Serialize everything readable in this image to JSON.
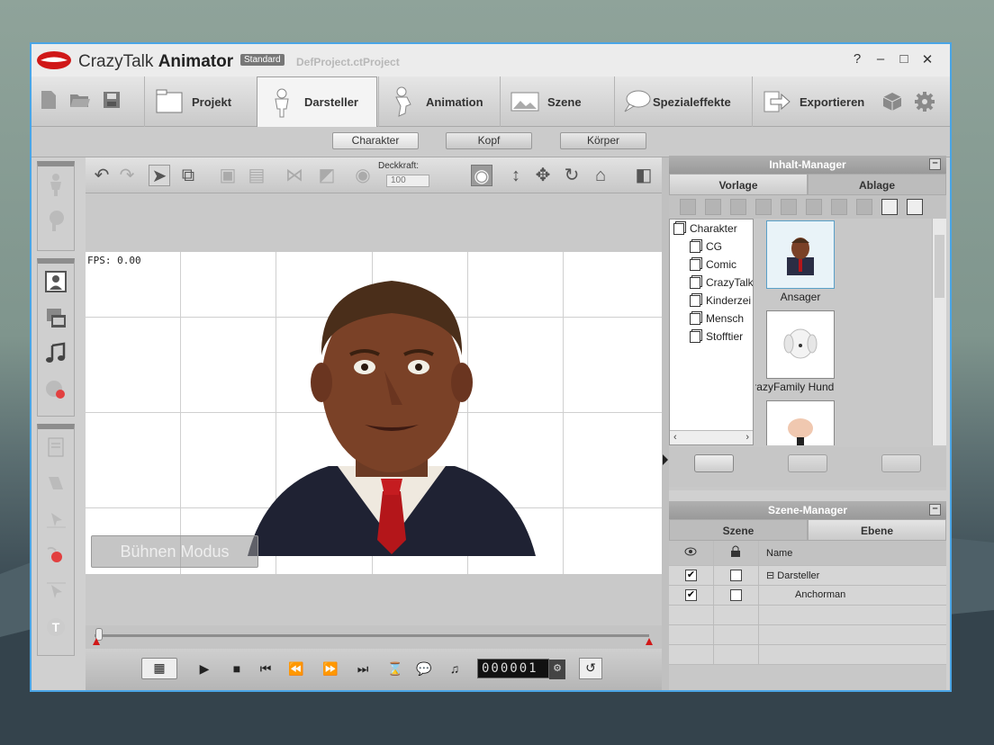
{
  "window": {
    "app_name_light": "CrazyTalk",
    "app_name_bold": "Animator",
    "edition": "Standard",
    "project": "DefProject.ctProject",
    "controls": [
      "?",
      "–",
      "□",
      "✕"
    ]
  },
  "toolbar": {
    "file_icons": [
      "new-file-icon",
      "open-folder-icon",
      "save-icon"
    ],
    "tabs": [
      {
        "label": "Projekt",
        "icon": "folder-icon"
      },
      {
        "label": "Darsteller",
        "icon": "actor-icon",
        "active": true
      },
      {
        "label": "Animation",
        "icon": "animation-icon"
      },
      {
        "label": "Szene",
        "icon": "scene-icon"
      },
      {
        "label": "Spezialeffekte",
        "icon": "effects-icon"
      },
      {
        "label": "Exportieren",
        "icon": "export-icon"
      }
    ],
    "extra_icons": [
      "dice-icon",
      "gear-icon"
    ]
  },
  "subtabs": [
    "Charakter",
    "Kopf",
    "Körper"
  ],
  "stage": {
    "opacity_label": "Deckkraft:",
    "opacity_value": "100",
    "fps": "FPS: 0.00",
    "stage_mode": "Bühnen Modus",
    "counter": "000001"
  },
  "content_manager": {
    "title": "Inhalt-Manager",
    "tabs": [
      "Vorlage",
      "Ablage"
    ],
    "tree_root": "Charakter",
    "tree_items": [
      "CG",
      "Comic",
      "CrazyTalk",
      "Kinderzei",
      "Mensch",
      "Stofftier"
    ],
    "thumbs": [
      "Ansager",
      "CrazyFamily Hund"
    ]
  },
  "scene_manager": {
    "title": "Szene-Manager",
    "tabs": [
      "Szene",
      "Ebene"
    ],
    "col_name": "Name",
    "rows": [
      {
        "name": "⊟ Darsteller",
        "visible": true
      },
      {
        "name": "Anchorman",
        "visible": true
      }
    ]
  },
  "colors": {
    "window_border": "#4aa5e6",
    "accent_red": "#d01818"
  }
}
